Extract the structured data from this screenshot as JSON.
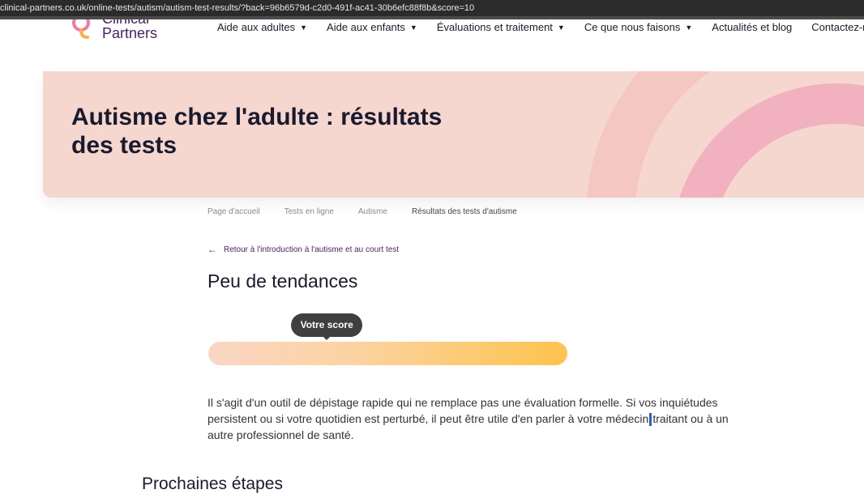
{
  "browser": {
    "url": "clinical-partners.co.uk/online-tests/autism/autism-test-results/?back=96b6579d-c2d0-491f-ac41-30b6efc88f8b&score=10"
  },
  "brand": {
    "line1": "Clinical",
    "line2": "Partners",
    "accent": "#4a1f6b",
    "mark_colors": [
      "#f07aa0",
      "#f7b04d"
    ]
  },
  "nav": {
    "items": [
      {
        "label": "Aide aux adultes",
        "has_dropdown": true
      },
      {
        "label": "Aide aux enfants",
        "has_dropdown": true
      },
      {
        "label": "Évaluations et traitement",
        "has_dropdown": true
      },
      {
        "label": "Ce que nous faisons",
        "has_dropdown": true
      },
      {
        "label": "Actualités et blog",
        "has_dropdown": false
      },
      {
        "label": "Contactez-nous",
        "has_dropdown": false
      }
    ],
    "chevron_icon": "chevron-down-icon"
  },
  "hero": {
    "title": "Autisme chez l'adulte : résultats des tests",
    "background": "#f6d7cf",
    "arc_color": "#f2b1bf"
  },
  "breadcrumb": {
    "items": [
      "Page d'accueil",
      "Tests en ligne",
      "Autisme",
      "Résultats des tests d'autisme"
    ]
  },
  "back_link": {
    "icon": "arrow-left-icon",
    "label": "Retour à l'introduction à l'autisme et au court test"
  },
  "result": {
    "title": "Peu de tendances",
    "score_tooltip": "Votre score",
    "score_position_fraction": 0.33,
    "bar_colors": [
      "#f9d6c4",
      "#fdc34d"
    ]
  },
  "description": {
    "part1": "Il s'agit d'un outil de dépistage rapide qui ne remplace pas une évaluation formelle. Si vos inquiétudes persistent ou si votre quotidien est perturbé, il peut être utile d'en parler à votre médecin",
    "part2": "traitant ou à un autre professionnel de santé."
  },
  "next_steps": {
    "title": "Prochaines étapes"
  }
}
